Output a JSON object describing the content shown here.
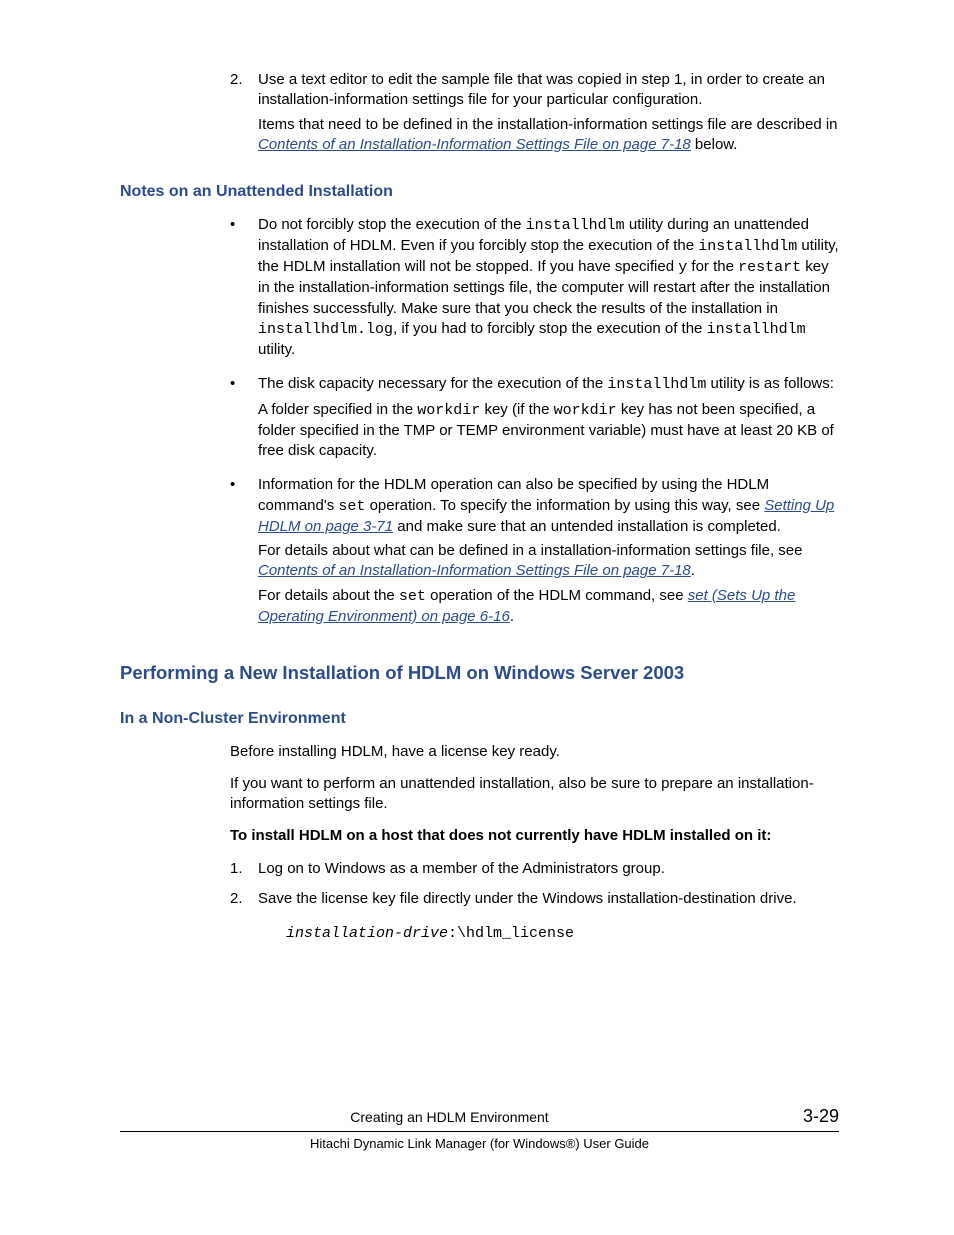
{
  "step2": {
    "num": "2.",
    "text1": "Use a text editor to edit the sample file that was copied in step 1, in order to create an installation-information settings file for your particular configuration.",
    "text2a": "Items that need to be defined in the installation-information settings file are described in ",
    "link2": "Contents of an Installation-Information Settings File on page 7-18",
    "text2b": " below."
  },
  "h_notes": "Notes on an Unattended Installation",
  "note1": {
    "a": "Do not forcibly stop the execution of the ",
    "c1": "installhdlm",
    "b": " utility during an unattended installation of HDLM. Even if you forcibly stop the execution of the ",
    "c2": "installhdlm",
    "c": " utility, the HDLM installation will not be stopped. If you have specified ",
    "c3": "y",
    "d": " for the ",
    "c4": "restart",
    "e": " key in the installation-information settings file, the computer will restart after the installation finishes successfully. Make sure that you check the results of the installation in ",
    "c5": "installhdlm.log",
    "f": ", if you had to forcibly stop the execution of the ",
    "c6": "installhdlm",
    "g": " utility."
  },
  "note2": {
    "a": "The disk capacity necessary for the execution of the ",
    "c1": "installhdlm",
    "b": " utility is as follows:",
    "p2a": "A folder specified in the ",
    "c2": "workdir",
    "p2b": " key (if the ",
    "c3": "workdir",
    "p2c": " key has not been specified, a folder specified in the TMP or TEMP environment variable) must have at least 20 KB of free disk capacity."
  },
  "note3": {
    "a": "Information for the HDLM operation can also be specified by using the HDLM command's ",
    "c1": "set",
    "b": " operation. To specify the information by using this way, see ",
    "link1": "Setting Up HDLM on page 3-71",
    "c": " and make sure that an untended installation is completed.",
    "p2a": "For details about what can be defined in a installation-information settings file, see ",
    "link2": "Contents of an Installation-Information Settings File on page 7-18",
    "p2b": ".",
    "p3a": "For details about the ",
    "c2": "set",
    "p3b": " operation of the HDLM command, see ",
    "link3": "set (Sets Up the Operating Environment) on page 6-16",
    "p3c": "."
  },
  "h_perf": "Performing a New Installation of HDLM on Windows Server 2003",
  "h_noncluster": "In a Non-Cluster Environment",
  "nc": {
    "p1": "Before installing HDLM, have a license key ready.",
    "p2": "If you want to perform an unattended installation, also be sure to prepare an installation-information settings file.",
    "bold": "To install HDLM on a host that does not currently have HDLM installed on it:",
    "s1num": "1.",
    "s1": "Log on to Windows as a member of the Administrators group.",
    "s2num": "2.",
    "s2": "Save the license key file directly under the Windows installation-destination drive.",
    "code_i": "installation-drive",
    "code_r": ":\\hdlm_license"
  },
  "footer": {
    "title": "Creating an HDLM Environment",
    "pageno": "3-29",
    "guide": "Hitachi Dynamic Link Manager (for Windows®) User Guide"
  }
}
